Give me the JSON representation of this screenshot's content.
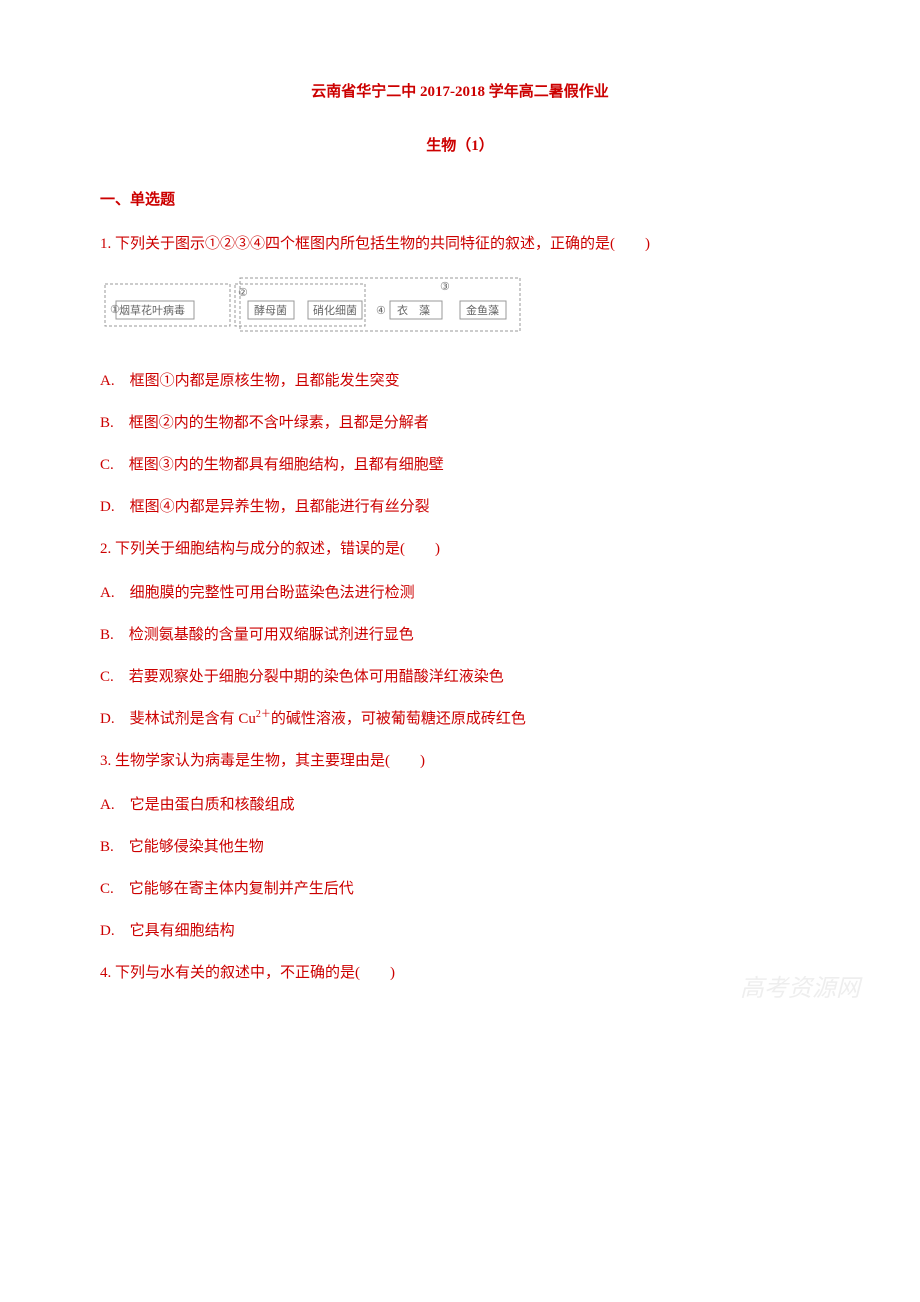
{
  "title": "云南省华宁二中 2017-2018 学年高二暑假作业",
  "subtitle": "生物（1）",
  "section_header": "一、单选题",
  "q1": {
    "text": "1. 下列关于图示①②③④四个框图内所包括生物的共同特征的叙述，正确的是(　　)",
    "diagram": {
      "circle1": "①",
      "circle2": "②",
      "circle3": "③",
      "circle4": "④",
      "label1": "烟草花叶病毒",
      "label2": "酵母菌",
      "label3": "硝化细菌",
      "label4": "衣　藻",
      "label5": "金鱼藻"
    },
    "A": "A.　框图①内都是原核生物，且都能发生突变",
    "B": "B.　框图②内的生物都不含叶绿素，且都是分解者",
    "C": "C.　框图③内的生物都具有细胞结构，且都有细胞壁",
    "D": "D.　框图④内都是异养生物，且都能进行有丝分裂"
  },
  "q2": {
    "text": "2. 下列关于细胞结构与成分的叙述，错误的是(　　)",
    "A": "A.　细胞膜的完整性可用台盼蓝染色法进行检测",
    "B": "B.　检测氨基酸的含量可用双缩脲试剂进行显色",
    "C": "C.　若要观察处于细胞分裂中期的染色体可用醋酸洋红液染色",
    "D_pre": "D.　斐林试剂是含有 Cu",
    "D_sup": "2＋",
    "D_post": "的碱性溶液，可被葡萄糖还原成砖红色"
  },
  "q3": {
    "text": "3. 生物学家认为病毒是生物，其主要理由是(　　)",
    "A": "A.　它是由蛋白质和核酸组成",
    "B": "B.　它能够侵染其他生物",
    "C": "C.　它能够在寄主体内复制并产生后代",
    "D": "D.　它具有细胞结构"
  },
  "q4": {
    "text": "4. 下列与水有关的叙述中，不正确的是(　　)"
  },
  "watermark": "高考资源网"
}
